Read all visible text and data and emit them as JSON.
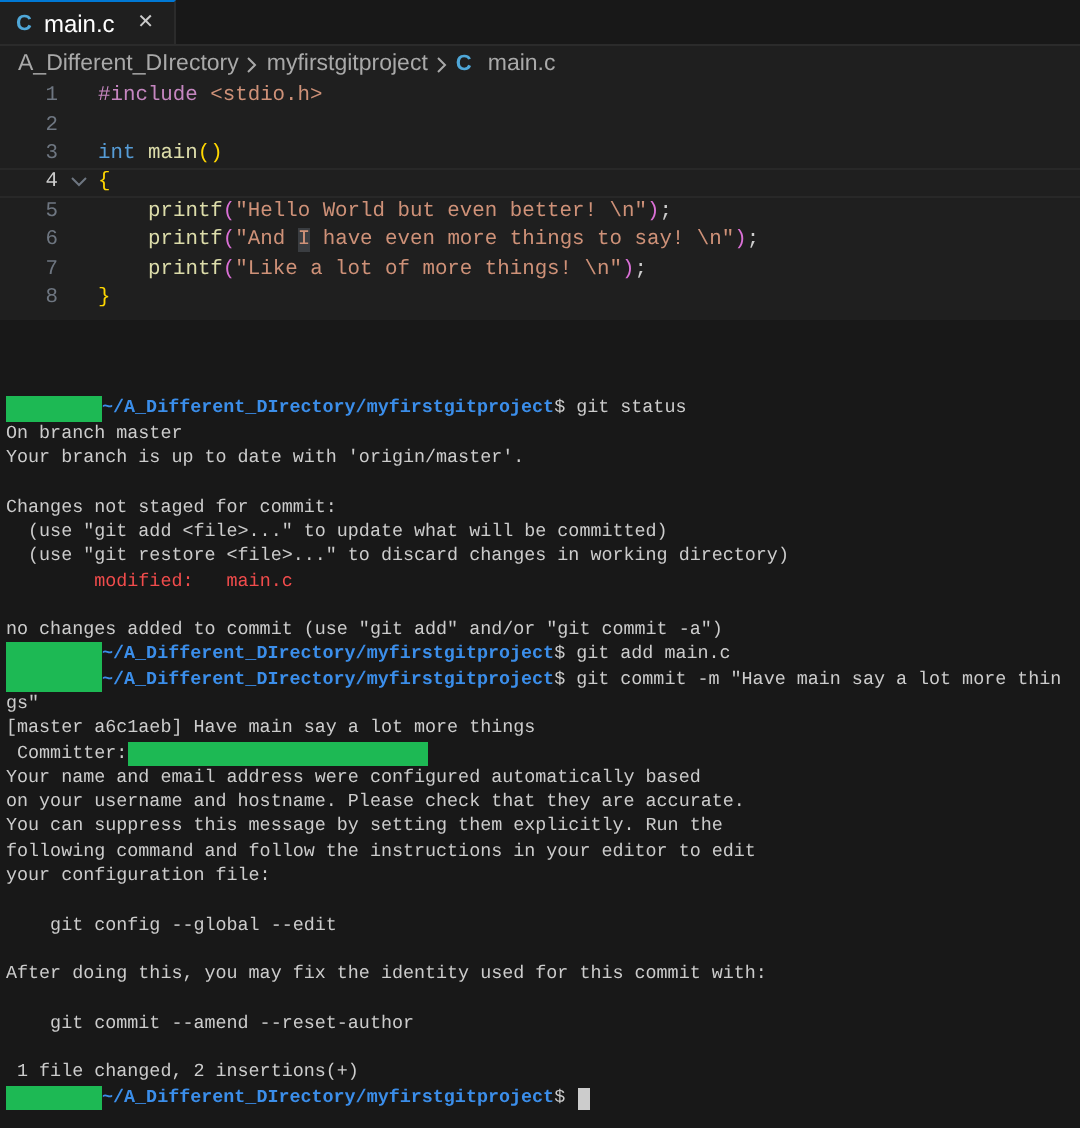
{
  "tabs": [
    {
      "icon": "C",
      "label": "main.c",
      "selected": true,
      "close": "✕"
    }
  ],
  "breadcrumb": [
    {
      "label": "A_Different_DIrectory",
      "kind": "folder"
    },
    {
      "label": "myfirstgitproject",
      "kind": "folder"
    },
    {
      "label": "main.c",
      "kind": "file",
      "icon": "C"
    }
  ],
  "code": [
    {
      "number": "1",
      "current": false,
      "tokens": [
        {
          "kind": "preproc",
          "text": "#include "
        },
        {
          "kind": "string",
          "text": "<stdio.h>"
        }
      ]
    },
    {
      "number": "2",
      "current": false
    },
    {
      "number": "3",
      "current": false,
      "tokens": [
        {
          "kind": "keyword",
          "text": "int "
        },
        {
          "kind": "func",
          "text": "main"
        },
        {
          "kind": "paren",
          "text": "()"
        }
      ]
    },
    {
      "number": "4",
      "current": true,
      "tokens": [
        {
          "kind": "paren",
          "text": "{"
        }
      ]
    },
    {
      "number": "5",
      "current": false,
      "indented": true,
      "tokens": [
        {
          "kind": "func",
          "text": "printf"
        },
        {
          "kind": "paren2",
          "text": "("
        },
        {
          "kind": "string",
          "text": "\"Hello World but even better! \\n\""
        },
        {
          "kind": "paren2",
          "text": ")"
        },
        {
          "kind": "plain",
          "text": ";"
        }
      ]
    },
    {
      "number": "6",
      "current": false,
      "indented": true,
      "tokens": [
        {
          "kind": "func",
          "text": "printf"
        },
        {
          "kind": "paren2",
          "text": "("
        },
        {
          "kind": "string",
          "text": "\"And "
        },
        {
          "kind": "string-highlight",
          "text": "I"
        },
        {
          "kind": "string",
          "text": " have even more things to say! \\n\""
        },
        {
          "kind": "paren2",
          "text": ")"
        },
        {
          "kind": "plain",
          "text": ";"
        }
      ]
    },
    {
      "number": "7",
      "current": false,
      "indented": true,
      "tokens": [
        {
          "kind": "func",
          "text": "printf"
        },
        {
          "kind": "paren2",
          "text": "("
        },
        {
          "kind": "string",
          "text": "\"Like a lot of more things! \\n\""
        },
        {
          "kind": "paren2",
          "text": ")"
        },
        {
          "kind": "plain",
          "text": ";"
        }
      ]
    },
    {
      "number": "8",
      "current": false,
      "tokens": [
        {
          "kind": "paren",
          "text": "}"
        }
      ]
    }
  ],
  "terminal": [
    {
      "kind": "blank"
    },
    {
      "kind": "prompt",
      "path": "~/A_Different_DIrectory/myfirstgitproject",
      "symbol": "$",
      "command": " git status"
    },
    {
      "kind": "text",
      "text": "On branch master"
    },
    {
      "kind": "text",
      "text": "Your branch is up to date with 'origin/master'."
    },
    {
      "kind": "blank"
    },
    {
      "kind": "text",
      "text": "Changes not staged for commit:"
    },
    {
      "kind": "text",
      "text": "  (use \"git add <file>...\" to update what will be committed)"
    },
    {
      "kind": "text",
      "text": "  (use \"git restore <file>...\" to discard changes in working directory)"
    },
    {
      "kind": "modified",
      "label": "        modified:",
      "file": "   main.c"
    },
    {
      "kind": "blank"
    },
    {
      "kind": "text",
      "text": "no changes added to commit (use \"git add\" and/or \"git commit -a\")"
    },
    {
      "kind": "prompt",
      "path": "~/A_Different_DIrectory/myfirstgitproject",
      "symbol": "$",
      "command": " git add main.c"
    },
    {
      "kind": "prompt",
      "path": "~/A_Different_DIrectory/myfirstgitproject",
      "symbol": "$",
      "command": " git commit -m \"Have main say a lot more thin"
    },
    {
      "kind": "text",
      "text": "gs\""
    },
    {
      "kind": "text",
      "text": "[master a6c1aeb] Have main say a lot more things"
    },
    {
      "kind": "committer",
      "label": " Committer:"
    },
    {
      "kind": "text",
      "text": "Your name and email address were configured automatically based"
    },
    {
      "kind": "text",
      "text": "on your username and hostname. Please check that they are accurate."
    },
    {
      "kind": "text",
      "text": "You can suppress this message by setting them explicitly. Run the"
    },
    {
      "kind": "text",
      "text": "following command and follow the instructions in your editor to edit"
    },
    {
      "kind": "text",
      "text": "your configuration file:"
    },
    {
      "kind": "blank"
    },
    {
      "kind": "text",
      "text": "    git config --global --edit"
    },
    {
      "kind": "blank"
    },
    {
      "kind": "text",
      "text": "After doing this, you may fix the identity used for this commit with:"
    },
    {
      "kind": "blank"
    },
    {
      "kind": "text",
      "text": "    git commit --amend --reset-author"
    },
    {
      "kind": "blank"
    },
    {
      "kind": "text",
      "text": " 1 file changed, 2 insertions(+)"
    },
    {
      "kind": "active-prompt",
      "path": "~/A_Different_DIrectory/myfirstgitproject",
      "symbol": "$"
    }
  ]
}
